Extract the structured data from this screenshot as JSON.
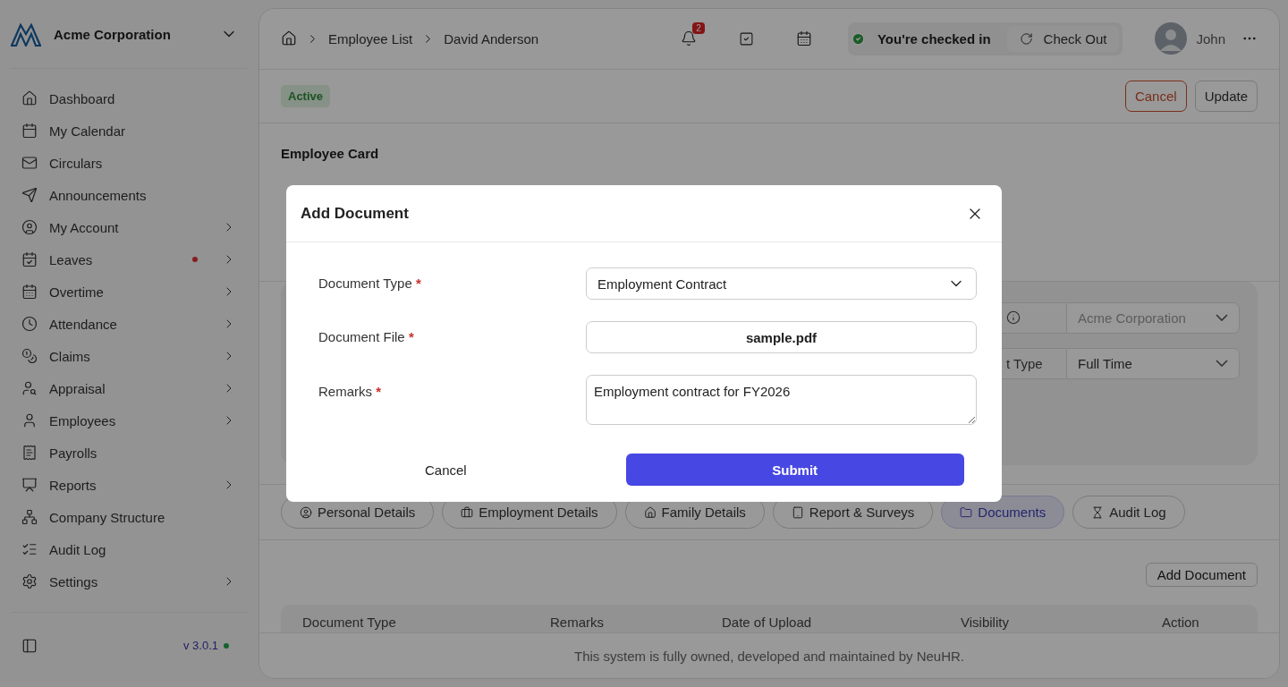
{
  "sidebar": {
    "company": "Acme Corporation",
    "items": [
      {
        "label": "Dashboard",
        "expandable": false,
        "alert": false
      },
      {
        "label": "My Calendar",
        "expandable": false,
        "alert": false
      },
      {
        "label": "Circulars",
        "expandable": false,
        "alert": false
      },
      {
        "label": "Announcements",
        "expandable": false,
        "alert": false
      },
      {
        "label": "My Account",
        "expandable": true,
        "alert": false
      },
      {
        "label": "Leaves",
        "expandable": true,
        "alert": true
      },
      {
        "label": "Overtime",
        "expandable": true,
        "alert": false
      },
      {
        "label": "Attendance",
        "expandable": true,
        "alert": false
      },
      {
        "label": "Claims",
        "expandable": true,
        "alert": false
      },
      {
        "label": "Appraisal",
        "expandable": true,
        "alert": false
      },
      {
        "label": "Employees",
        "expandable": true,
        "alert": false
      },
      {
        "label": "Payrolls",
        "expandable": false,
        "alert": false
      },
      {
        "label": "Reports",
        "expandable": true,
        "alert": false
      },
      {
        "label": "Company Structure",
        "expandable": false,
        "alert": false
      },
      {
        "label": "Audit Log",
        "expandable": false,
        "alert": false
      },
      {
        "label": "Settings",
        "expandable": true,
        "alert": false
      }
    ],
    "version": "v 3.0.1"
  },
  "header": {
    "breadcrumbs": [
      "Employee List",
      "David Anderson"
    ],
    "notification_count": "2",
    "check_status": "You're checked in",
    "check_button": "Check Out",
    "user": "John"
  },
  "toolbar": {
    "status": "Active",
    "buttons": [
      {
        "label": "Cancel",
        "kind": "danger"
      },
      {
        "label": "Update",
        "kind": "default"
      }
    ]
  },
  "employee_card": {
    "title": "Employee Card",
    "company_value": "Acme Corporation",
    "type_label": "t Type",
    "type_value": "Full Time"
  },
  "tabs": [
    {
      "label": "Personal Details",
      "selected": false
    },
    {
      "label": "Employment Details",
      "selected": false
    },
    {
      "label": "Family Details",
      "selected": false
    },
    {
      "label": "Report & Surveys",
      "selected": false
    },
    {
      "label": "Documents",
      "selected": true
    },
    {
      "label": "Audit Log",
      "selected": false
    }
  ],
  "documents": {
    "add_button": "Add Document",
    "columns": [
      "Document Type",
      "Remarks",
      "Date of Upload",
      "Visibility",
      "Action"
    ]
  },
  "footer": "This system is fully owned, developed and maintained by NeuHR.",
  "modal": {
    "title": "Add Document",
    "fields": [
      {
        "label": "Document Type",
        "required_mark": "*",
        "kind": "select",
        "value": "Employment Contract"
      },
      {
        "label": "Document File",
        "required_mark": "*",
        "kind": "file",
        "value": "sample.pdf"
      },
      {
        "label": "Remarks",
        "required_mark": "*",
        "kind": "textarea",
        "value": "Employment contract for FY2026"
      }
    ],
    "cancel": "Cancel",
    "submit": "Submit"
  }
}
